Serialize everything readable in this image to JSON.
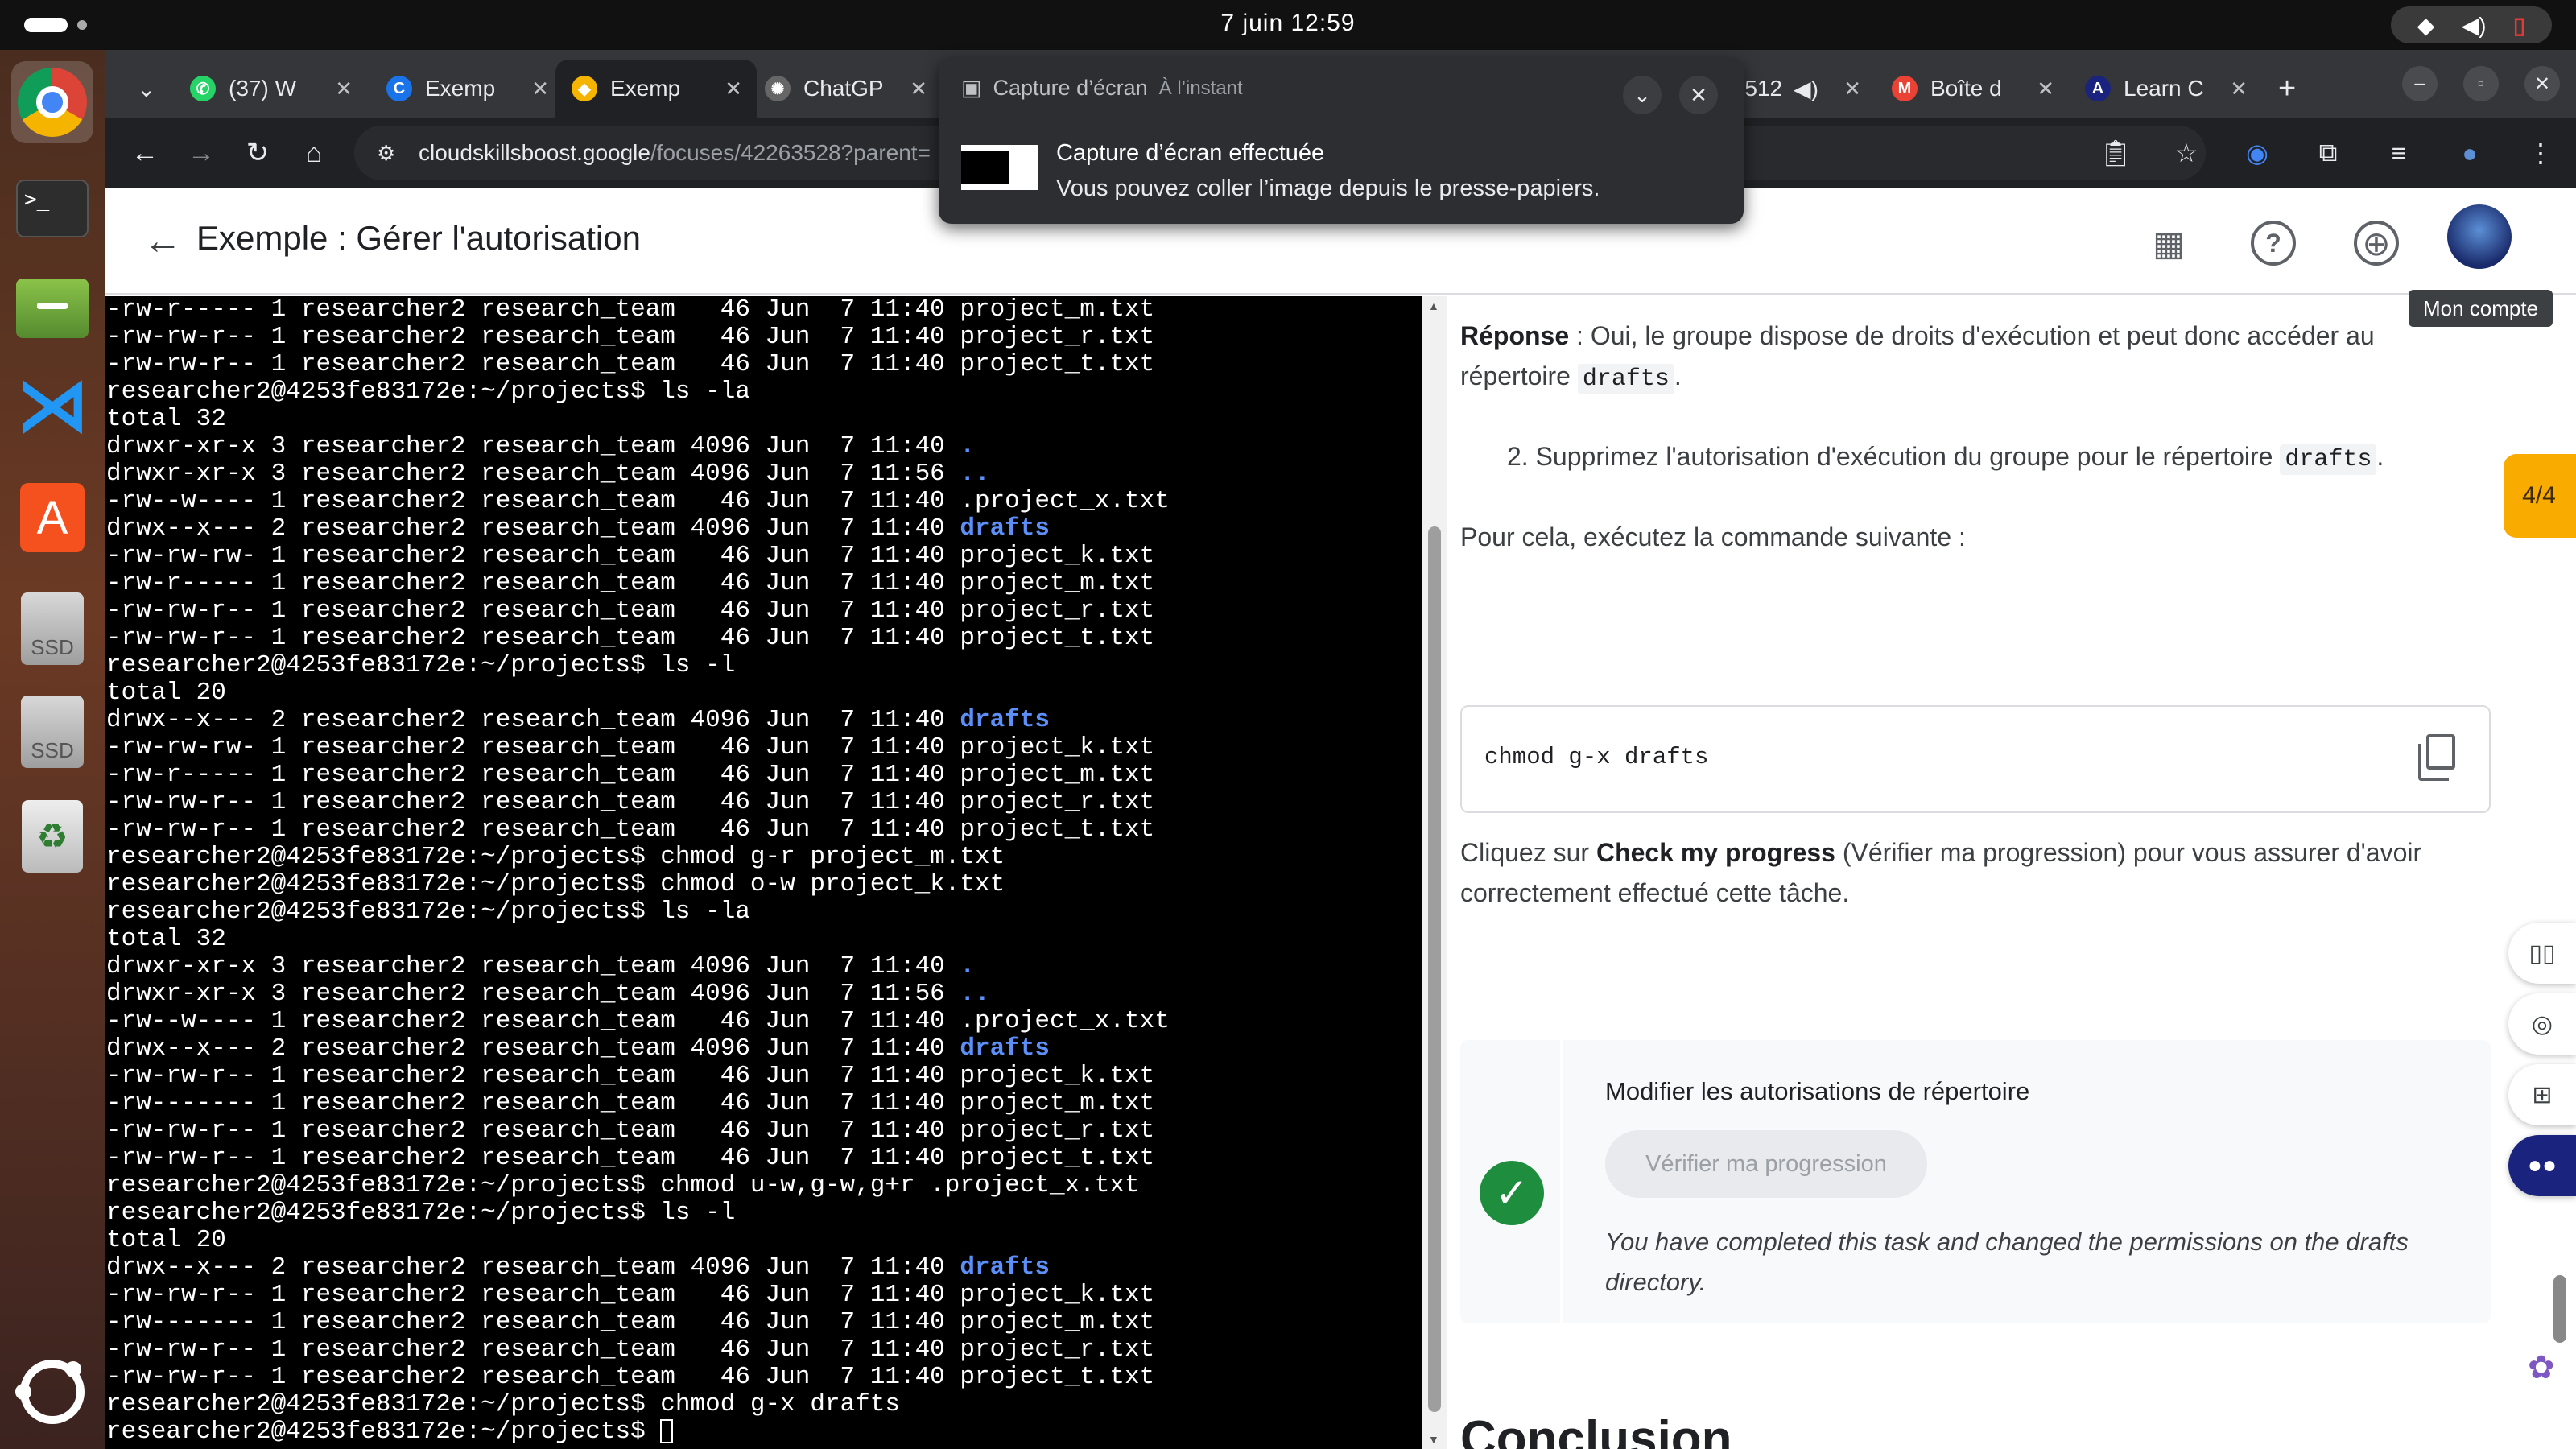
{
  "system": {
    "clock": "7 juin  12:59"
  },
  "dock": {
    "items": [
      "chrome",
      "terminal",
      "files",
      "vscode",
      "app-center",
      "ssd-1",
      "ssd-2",
      "trash",
      "show-apps"
    ],
    "ssd_label": "SSD"
  },
  "browser": {
    "tabs": [
      {
        "label": "(37) W",
        "icon": "whatsapp-icon",
        "color": "#25d366"
      },
      {
        "label": "Exemp",
        "icon": "coursera-icon",
        "color": "#1a73e8"
      },
      {
        "label": "Exemp",
        "icon": "google-cloud-icon",
        "color": "#f4b400",
        "active": true
      },
      {
        "label": "ChatGP",
        "icon": "openai-icon",
        "color": "#888888"
      },
      {
        "label": "(512",
        "icon": "youtube-icon",
        "color": "#ff0000"
      },
      {
        "label": "Boîte d",
        "icon": "gmail-icon",
        "color": "#ea4335"
      },
      {
        "label": "Learn C",
        "icon": "learn-icon",
        "color": "#1a237e"
      }
    ],
    "url_host": "cloudskillsboost.google",
    "url_path": "/focuses/42263528?parent="
  },
  "notification": {
    "app": "Capture d’écran",
    "time": "À l’instant",
    "title": "Capture d’écran effectuée",
    "body": "Vous pouvez coller l’image depuis le presse-papiers."
  },
  "page": {
    "title": "Exemple : Gérer l'autorisation",
    "account_tooltip": "Mon compte",
    "step_indicator": "4/4"
  },
  "terminal": {
    "lines": [
      "-rw-r----- 1 researcher2 research_team   46 Jun  7 11:40 project_m.txt",
      "-rw-rw-r-- 1 researcher2 research_team   46 Jun  7 11:40 project_r.txt",
      "-rw-rw-r-- 1 researcher2 research_team   46 Jun  7 11:40 project_t.txt",
      "researcher2@4253fe83172e:~/projects$ ls -la",
      "total 32",
      "drwxr-xr-x 3 researcher2 research_team 4096 Jun  7 11:40 |.",
      "drwxr-xr-x 3 researcher2 research_team 4096 Jun  7 11:56 |..",
      "-rw--w---- 1 researcher2 research_team   46 Jun  7 11:40 .project_x.txt",
      "drwx--x--- 2 researcher2 research_team 4096 Jun  7 11:40 |drafts",
      "-rw-rw-rw- 1 researcher2 research_team   46 Jun  7 11:40 project_k.txt",
      "-rw-r----- 1 researcher2 research_team   46 Jun  7 11:40 project_m.txt",
      "-rw-rw-r-- 1 researcher2 research_team   46 Jun  7 11:40 project_r.txt",
      "-rw-rw-r-- 1 researcher2 research_team   46 Jun  7 11:40 project_t.txt",
      "researcher2@4253fe83172e:~/projects$ ls -l",
      "total 20",
      "drwx--x--- 2 researcher2 research_team 4096 Jun  7 11:40 |drafts",
      "-rw-rw-rw- 1 researcher2 research_team   46 Jun  7 11:40 project_k.txt",
      "-rw-r----- 1 researcher2 research_team   46 Jun  7 11:40 project_m.txt",
      "-rw-rw-r-- 1 researcher2 research_team   46 Jun  7 11:40 project_r.txt",
      "-rw-rw-r-- 1 researcher2 research_team   46 Jun  7 11:40 project_t.txt",
      "researcher2@4253fe83172e:~/projects$ chmod g-r project_m.txt",
      "researcher2@4253fe83172e:~/projects$ chmod o-w project_k.txt",
      "researcher2@4253fe83172e:~/projects$ ls -la",
      "total 32",
      "drwxr-xr-x 3 researcher2 research_team 4096 Jun  7 11:40 |.",
      "drwxr-xr-x 3 researcher2 research_team 4096 Jun  7 11:56 |..",
      "-rw--w---- 1 researcher2 research_team   46 Jun  7 11:40 .project_x.txt",
      "drwx--x--- 2 researcher2 research_team 4096 Jun  7 11:40 |drafts",
      "-rw-rw-r-- 1 researcher2 research_team   46 Jun  7 11:40 project_k.txt",
      "-rw------- 1 researcher2 research_team   46 Jun  7 11:40 project_m.txt",
      "-rw-rw-r-- 1 researcher2 research_team   46 Jun  7 11:40 project_r.txt",
      "-rw-rw-r-- 1 researcher2 research_team   46 Jun  7 11:40 project_t.txt",
      "researcher2@4253fe83172e:~/projects$ chmod u-w,g-w,g+r .project_x.txt",
      "researcher2@4253fe83172e:~/projects$ ls -l",
      "total 20",
      "drwx--x--- 2 researcher2 research_team 4096 Jun  7 11:40 |drafts",
      "-rw-rw-r-- 1 researcher2 research_team   46 Jun  7 11:40 project_k.txt",
      "-rw------- 1 researcher2 research_team   46 Jun  7 11:40 project_m.txt",
      "-rw-rw-r-- 1 researcher2 research_team   46 Jun  7 11:40 project_r.txt",
      "-rw-rw-r-- 1 researcher2 research_team   46 Jun  7 11:40 project_t.txt",
      "researcher2@4253fe83172e:~/projects$ chmod g-x drafts",
      "researcher2@4253fe83172e:~/projects$ "
    ]
  },
  "lab": {
    "answer_label": "Réponse",
    "answer_text_1": " : Oui, le groupe dispose de droits d'exécution et peut donc accéder au",
    "answer_text_2": "répertoire ",
    "answer_code": "drafts",
    "step_number": "2.",
    "step_text": "Supprimez l'autorisation d'exécution du groupe pour le répertoire ",
    "step_code": "drafts",
    "run_text": "Pour cela, exécutez la commande suivante :",
    "command": "chmod g-x drafts",
    "click_text_1": "Cliquez sur ",
    "click_bold": "Check my progress",
    "click_text_2": " (Vérifier ma progression) pour vous assurer d'avoir",
    "click_text_3": "correctement effectué cette tâche.",
    "task_title": "Modifier les autorisations de répertoire",
    "verify_button": "Vérifier ma progression",
    "task_done_1": "You have completed this task and changed the permissions on the drafts",
    "task_done_2": "directory.",
    "conclusion": "Conclusion"
  }
}
